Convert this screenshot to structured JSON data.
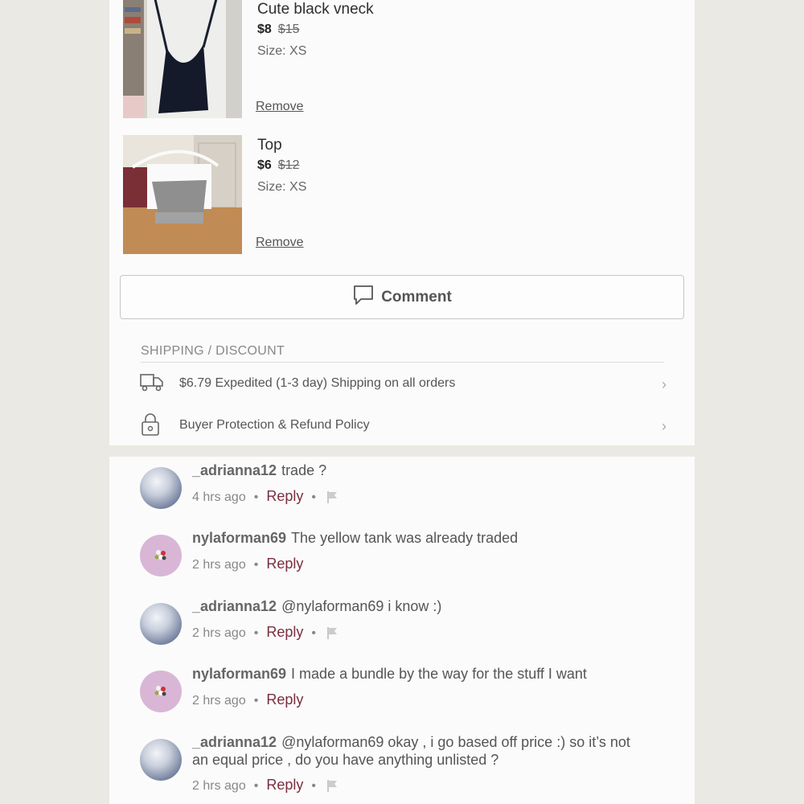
{
  "items": [
    {
      "title": "Cute black vneck",
      "price": "$8",
      "original_price": "$15",
      "size": "Size: XS",
      "remove_label": "Remove"
    },
    {
      "title": "Top",
      "price": "$6",
      "original_price": "$12",
      "size": "Size: XS",
      "remove_label": "Remove"
    }
  ],
  "comment_button": {
    "label": "Comment",
    "icon": "speech-bubble-icon"
  },
  "shipping": {
    "title": "SHIPPING / DISCOUNT",
    "rows": [
      {
        "text": "$6.79 Expedited (1-3 day) Shipping on all orders",
        "icon": "truck-icon"
      },
      {
        "text": "Buyer Protection & Refund Policy",
        "icon": "lock-icon"
      }
    ]
  },
  "comments": [
    {
      "user": "_adrianna12",
      "text": "trade ?",
      "time": "4 hrs ago",
      "reply": "Reply",
      "dot": "•"
    },
    {
      "user": "nylaforman69",
      "text": "The yellow tank was already traded",
      "time": "2 hrs ago",
      "reply": "Reply",
      "dot": "•"
    },
    {
      "user": "_adrianna12",
      "text": "@nylaforman69 i know :)",
      "time": "2 hrs ago",
      "reply": "Reply",
      "dot": "•"
    },
    {
      "user": "nylaforman69",
      "text": "I made a bundle by the way for the stuff I want",
      "time": "2 hrs ago",
      "reply": "Reply",
      "dot": "•"
    },
    {
      "user": "_adrianna12",
      "text": "@nylaforman69 okay , i go based off price :) so it’s not an equal price , do you have anything unlisted ?",
      "time": "2 hrs ago",
      "reply": "Reply",
      "dot": "•"
    }
  ]
}
